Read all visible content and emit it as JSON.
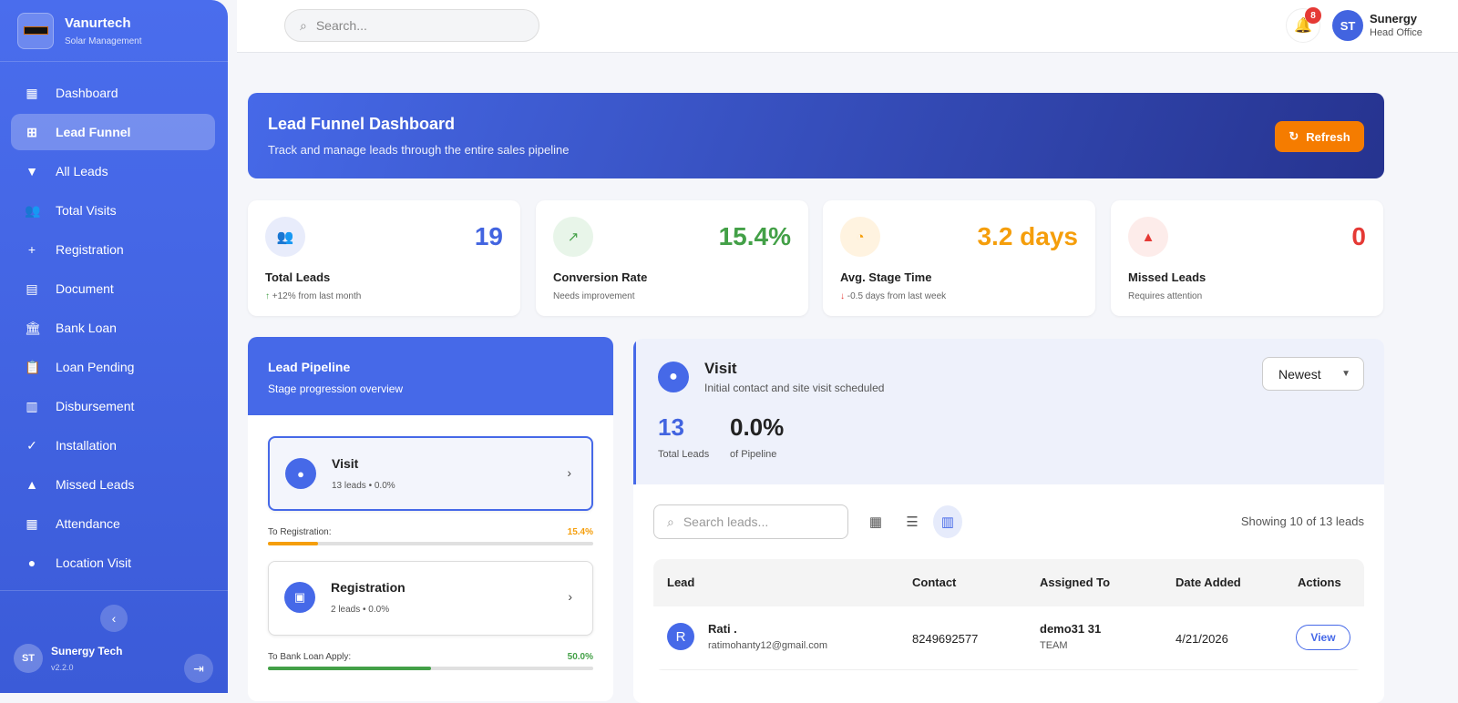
{
  "brand": {
    "name": "Vanurtech",
    "subtitle": "Solar Management"
  },
  "sidebar": {
    "items": [
      {
        "label": "Dashboard",
        "icon": "▦"
      },
      {
        "label": "Lead Funnel",
        "icon": "⊞"
      },
      {
        "label": "All Leads",
        "icon": "▼"
      },
      {
        "label": "Total Visits",
        "icon": "👥"
      },
      {
        "label": "Registration",
        "icon": "+"
      },
      {
        "label": "Document",
        "icon": "▤"
      },
      {
        "label": "Bank Loan",
        "icon": "🏛"
      },
      {
        "label": "Loan Pending",
        "icon": "📋"
      },
      {
        "label": "Disbursement",
        "icon": "▥"
      },
      {
        "label": "Installation",
        "icon": "✓"
      },
      {
        "label": "Missed Leads",
        "icon": "▲"
      },
      {
        "label": "Attendance",
        "icon": "▦"
      },
      {
        "label": "Location Visit",
        "icon": "●"
      }
    ],
    "user": {
      "initials": "ST",
      "name": "Sunergy Tech",
      "version": "v2.2.0"
    }
  },
  "header": {
    "search_placeholder": "Search...",
    "notifications": "8",
    "user_initials": "ST",
    "user_name": "Sunergy",
    "user_role": "Head Office"
  },
  "banner": {
    "title": "Lead Funnel Dashboard",
    "subtitle": "Track and manage leads through the entire sales pipeline",
    "refresh": "Refresh"
  },
  "stats": [
    {
      "value": "19",
      "title": "Total Leads",
      "sub": "+12% from last month",
      "color": "#4264e0"
    },
    {
      "value": "15.4%",
      "title": "Conversion Rate",
      "sub": "Needs improvement",
      "color": "#43a047"
    },
    {
      "value": "3.2 days",
      "title": "Avg. Stage Time",
      "sub": "-0.5 days from last week",
      "color": "#f59e0b"
    },
    {
      "value": "0",
      "title": "Missed Leads",
      "sub": "Requires attention",
      "color": "#e53935"
    }
  ],
  "pipeline": {
    "title": "Lead Pipeline",
    "subtitle": "Stage progression overview",
    "stages": [
      {
        "name": "Visit",
        "meta": "13 leads • 0.0%"
      },
      {
        "name": "Registration",
        "meta": "2 leads • 0.0%"
      }
    ],
    "conversions": [
      {
        "label": "To Registration:",
        "value": "15.4%",
        "progress": 15.4
      },
      {
        "label": "To Bank Loan Apply:",
        "value": "50.0%",
        "progress": 50
      }
    ]
  },
  "detail": {
    "stage": "Visit",
    "description": "Initial contact and site visit scheduled",
    "sort": "Newest",
    "total": "13",
    "total_label": "Total Leads",
    "share": "0.0%",
    "share_label": "of Pipeline",
    "search_placeholder": "Search leads...",
    "showing": "Showing 10 of 13 leads",
    "columns": [
      "Lead",
      "Contact",
      "Assigned To",
      "Date Added",
      "Actions"
    ],
    "rows": [
      {
        "initial": "R",
        "name": "Rati .",
        "email": "ratimohanty12@gmail.com",
        "contact": "8249692577",
        "assigned": "demo31 31",
        "team": "TEAM",
        "date": "4/21/2026",
        "action": "View"
      }
    ]
  }
}
